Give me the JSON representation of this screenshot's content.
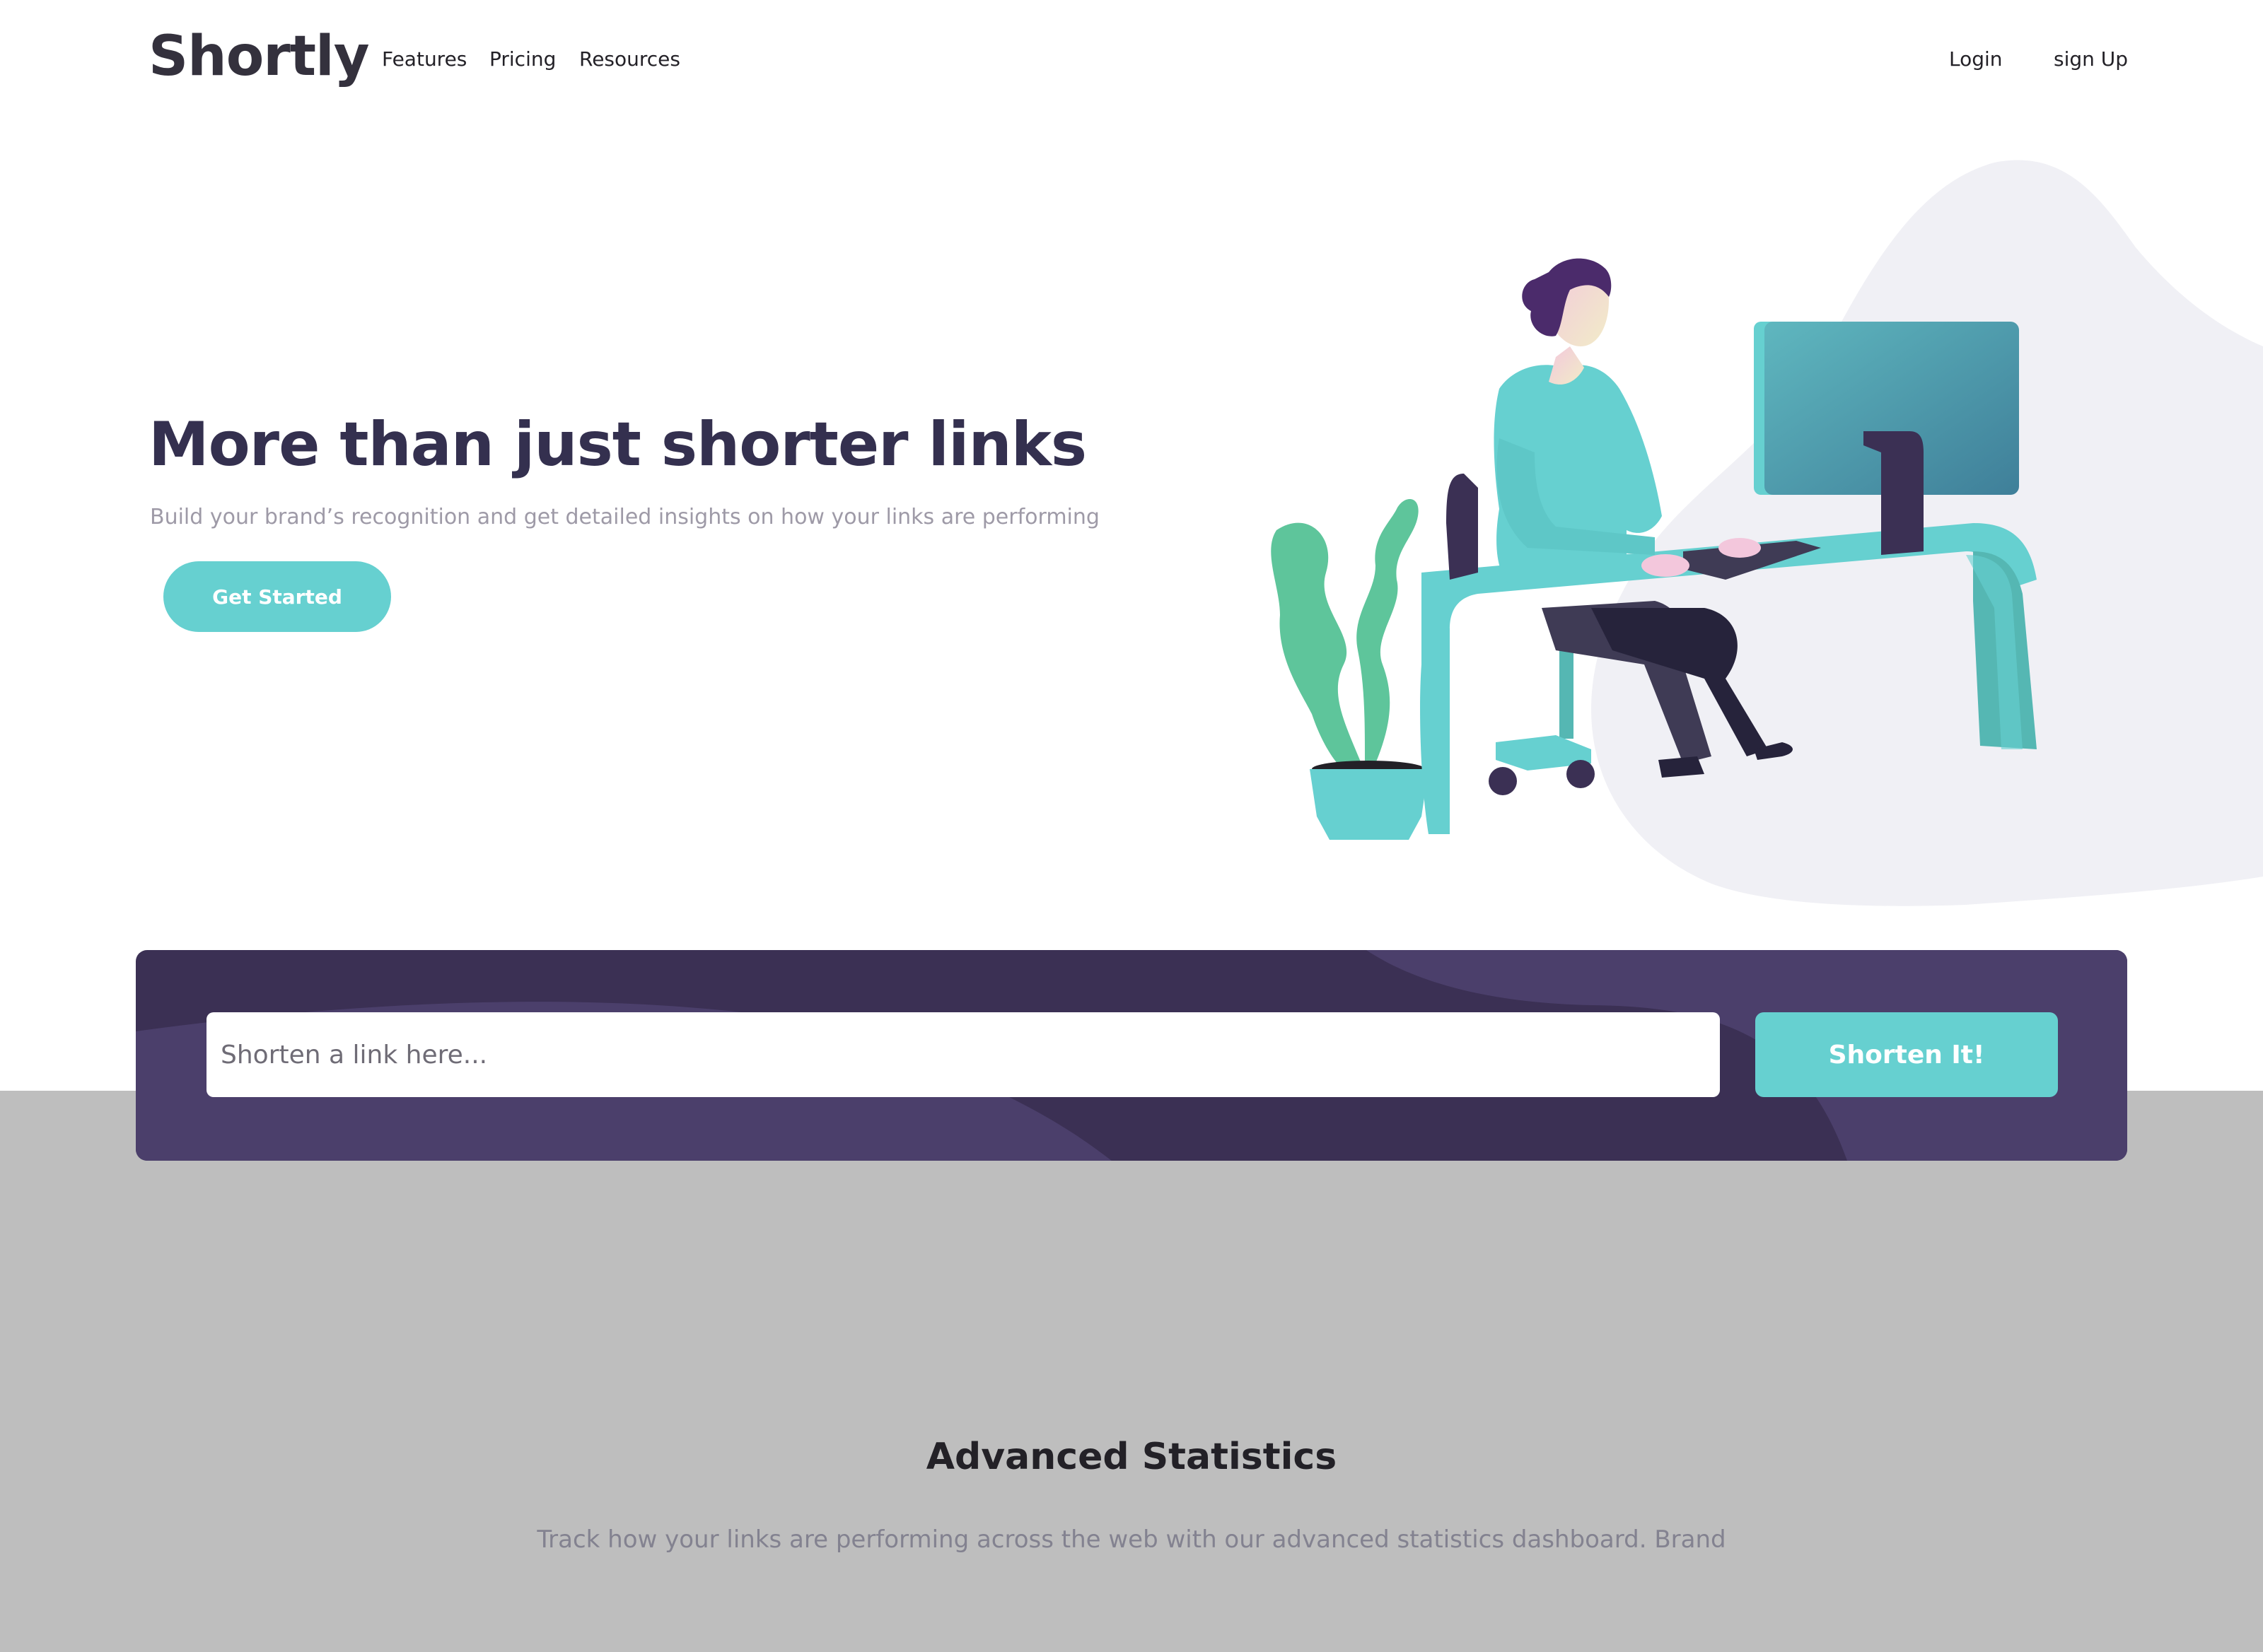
{
  "header": {
    "logo": "Shortly",
    "nav": [
      "Features",
      "Pricing",
      "Resources"
    ],
    "login": "Login",
    "signup": "sign Up"
  },
  "hero": {
    "title": "More than just shorter links",
    "subtitle": "Build your brand’s recognition and get detailed insights on how your links are performing",
    "cta": "Get Started"
  },
  "shortener": {
    "placeholder": "Shorten a link here...",
    "button": "Shorten It!"
  },
  "stats": {
    "title": "Advanced Statistics",
    "text": "Track how your links are performing across the web with our advanced statistics dashboard. Brand"
  },
  "colors": {
    "cyan": "#66d0d0",
    "dark_violet": "#3b3054",
    "very_dark_blue": "#34304f",
    "grey_section": "#bebebe"
  }
}
